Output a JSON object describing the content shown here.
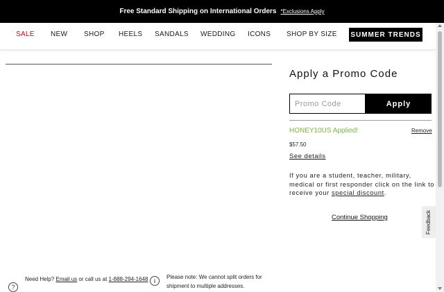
{
  "topbar": {
    "message": "Free Standard Shipping on International Orders",
    "exclusions": "*Exclusions Apply"
  },
  "nav": {
    "items": [
      "SALE",
      "NEW",
      "SHOP",
      "HEELS",
      "SANDALS",
      "WEDDING",
      "ICONS",
      "SHOP BY SIZE"
    ],
    "featured": "SUMMER TRENDS",
    "colors": {
      "sale": "#d0021b",
      "featured_bg": "#000000"
    }
  },
  "promo": {
    "title": "Apply a Promo Code",
    "placeholder": "Promo Code",
    "apply_label": "Apply",
    "applied_text": "HONEY10US Applied!",
    "remove_label": "Remove",
    "amount": "$57.50",
    "see_details": "See details",
    "student_text": "If you are a student, teacher, military, medical or first responder click on the link to receive your",
    "student_link": "special discount",
    "student_end": ".",
    "continue_label": "Continue Shopping",
    "applied_color": "#7cb342"
  },
  "feedback": {
    "label": "Feedback"
  },
  "footer": {
    "need_help_prefix": "Need Help?",
    "email_link": "Email us",
    "call_text": "or call us at",
    "phone": "1-888-294-1648",
    "split_note": "Please note: We cannot split orders for shipment to multiple addresses.",
    "help_icon": "question-circle-icon",
    "info_icon": "info-circle-icon"
  }
}
